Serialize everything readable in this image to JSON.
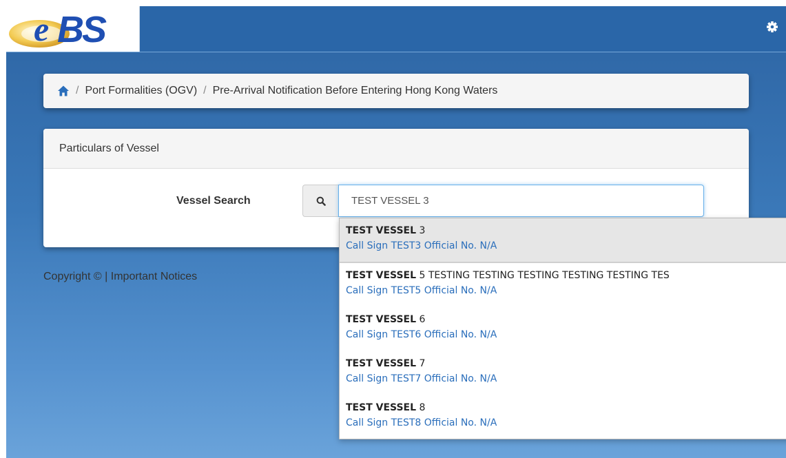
{
  "header": {
    "logo_text": "eBS",
    "settings_icon": "gear-icon"
  },
  "breadcrumb": {
    "home_icon": "home-icon",
    "separator": "/",
    "items": [
      "Port Formalities (OGV)",
      "Pre-Arrival Notification Before Entering Hong Kong Waters"
    ]
  },
  "panel": {
    "title": "Particulars of Vessel",
    "search_label": "Vessel Search",
    "search_icon": "search-icon",
    "search_value": "TEST VESSEL 3"
  },
  "footer": {
    "copyright": "Copyright ©",
    "separator": "|",
    "notices": "Important Notices"
  },
  "dropdown": {
    "items": [
      {
        "match": "TEST VESSEL",
        "rest": " 3",
        "sub": "Call Sign TEST3 Official No. N/A"
      },
      {
        "match": "TEST VESSEL",
        "rest": " 5 TESTING TESTING TESTING TESTING TESTING TES",
        "sub": "Call Sign TEST5 Official No. N/A"
      },
      {
        "match": "TEST VESSEL",
        "rest": " 6",
        "sub": "Call Sign TEST6 Official No. N/A"
      },
      {
        "match": "TEST VESSEL",
        "rest": " 7",
        "sub": "Call Sign TEST7 Official No. N/A"
      },
      {
        "match": "TEST VESSEL",
        "rest": " 8",
        "sub": "Call Sign TEST8 Official No. N/A"
      }
    ]
  },
  "colors": {
    "background": "#3a78b8",
    "header": "#2a66a8",
    "link": "#2a6ebb",
    "focus": "#66afe9"
  }
}
